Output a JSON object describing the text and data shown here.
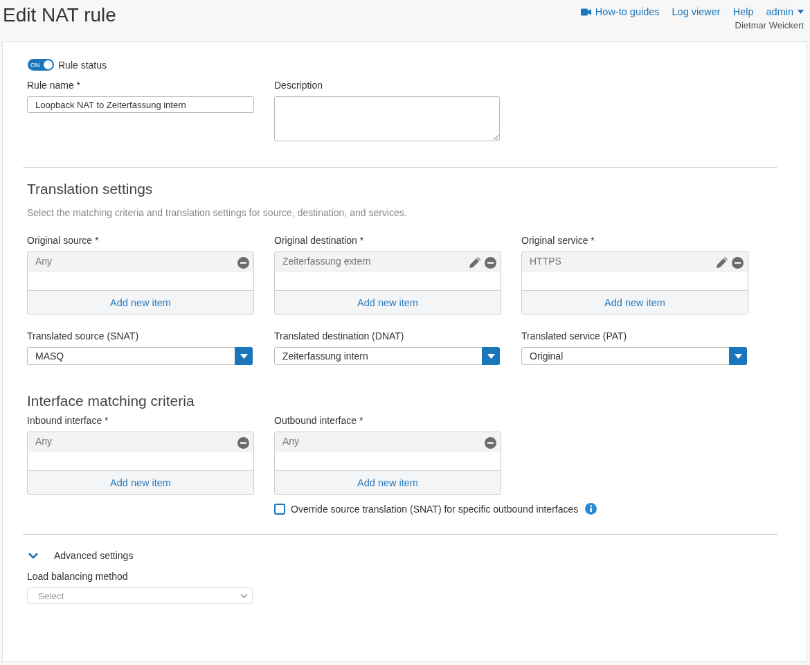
{
  "page": {
    "title": "Edit NAT rule"
  },
  "header_links": [
    {
      "label": "How-to guides",
      "kind": "video"
    },
    {
      "label": "Log viewer",
      "kind": "plain"
    },
    {
      "label": "Help",
      "kind": "plain"
    },
    {
      "label": "admin",
      "kind": "menu"
    }
  ],
  "user": "Dietmar Weickert",
  "rule_status": {
    "label": "Rule status",
    "toggle_text": "ON",
    "on": true
  },
  "rule_name": {
    "label": "Rule name *",
    "value": "Loopback NAT to Zeiterfassung intern"
  },
  "description": {
    "label": "Description"
  },
  "translation": {
    "heading": "Translation settings",
    "subtitle": "Select the matching criteria and translation settings for source, destination, and services.",
    "originals": [
      {
        "label": "Original source *",
        "items": [
          {
            "text": "Any",
            "editable": false
          }
        ],
        "add_label": "Add new item"
      },
      {
        "label": "Original destination *",
        "items": [
          {
            "text": "Zeiterfassung extern",
            "editable": true
          }
        ],
        "add_label": "Add new item"
      },
      {
        "label": "Original service *",
        "items": [
          {
            "text": "HTTPS",
            "editable": true
          }
        ],
        "add_label": "Add new item"
      }
    ],
    "translated": [
      {
        "label": "Translated source (SNAT)",
        "value": "MASQ"
      },
      {
        "label": "Translated destination (DNAT)",
        "value": "Zeiterfassung intern"
      },
      {
        "label": "Translated service (PAT)",
        "value": "Original"
      }
    ]
  },
  "interfaces": {
    "heading": "Interface matching criteria",
    "lists": [
      {
        "label": "Inbound interface *",
        "items": [
          {
            "text": "Any",
            "editable": false
          }
        ],
        "add_label": "Add new item"
      },
      {
        "label": "Outbound interface *",
        "items": [
          {
            "text": "Any",
            "editable": false
          }
        ],
        "add_label": "Add new item"
      }
    ],
    "override": {
      "label": "Override source translation (SNAT) for specific outbound interfaces",
      "checked": false
    }
  },
  "advanced": {
    "label": "Advanced settings",
    "expanded": true,
    "load_balancing": {
      "label": "Load balancing method",
      "placeholder": "Select"
    }
  }
}
